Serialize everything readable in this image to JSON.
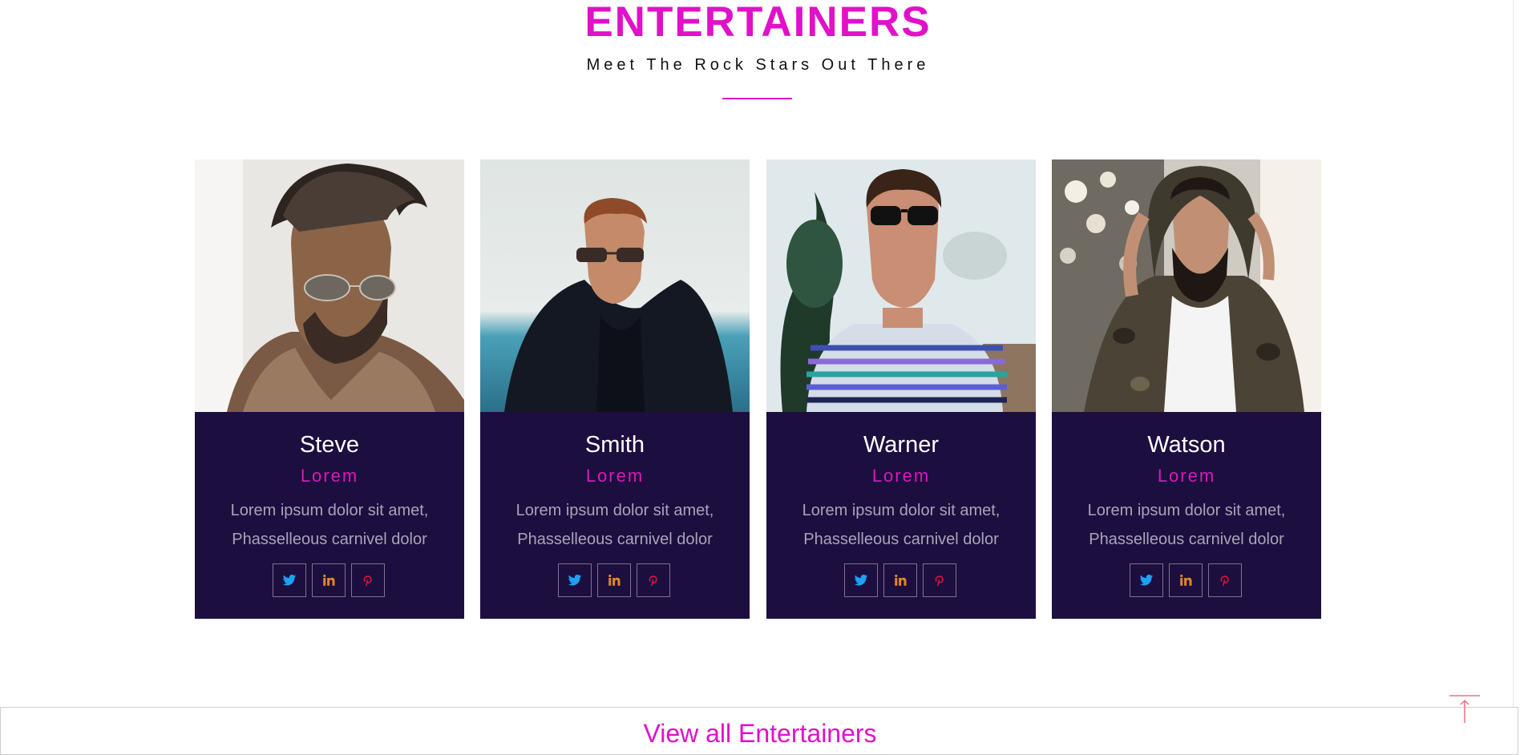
{
  "section": {
    "title": "ENTERTAINERS",
    "subtitle": "Meet The Rock Stars Out There"
  },
  "entertainers": [
    {
      "name": "Steve",
      "role": "Lorem",
      "desc_line1": "Lorem ipsum dolor sit amet,",
      "desc_line2": "Phasselleous carnivel dolor"
    },
    {
      "name": "Smith",
      "role": "Lorem",
      "desc_line1": "Lorem ipsum dolor sit amet,",
      "desc_line2": "Phasselleous carnivel dolor"
    },
    {
      "name": "Warner",
      "role": "Lorem",
      "desc_line1": "Lorem ipsum dolor sit amet,",
      "desc_line2": "Phasselleous carnivel dolor"
    },
    {
      "name": "Watson",
      "role": "Lorem",
      "desc_line1": "Lorem ipsum dolor sit amet,",
      "desc_line2": "Phasselleous carnivel dolor"
    }
  ],
  "social_icons": [
    "twitter-icon",
    "linkedin-icon",
    "pinterest-icon"
  ],
  "view_all": {
    "label": "View all Entertainers"
  },
  "colors": {
    "accent": "#e011c8",
    "card_bg": "#1d0e40",
    "twitter": "#1da1f2",
    "linkedin": "#e0862a",
    "pinterest": "#d0153a"
  }
}
